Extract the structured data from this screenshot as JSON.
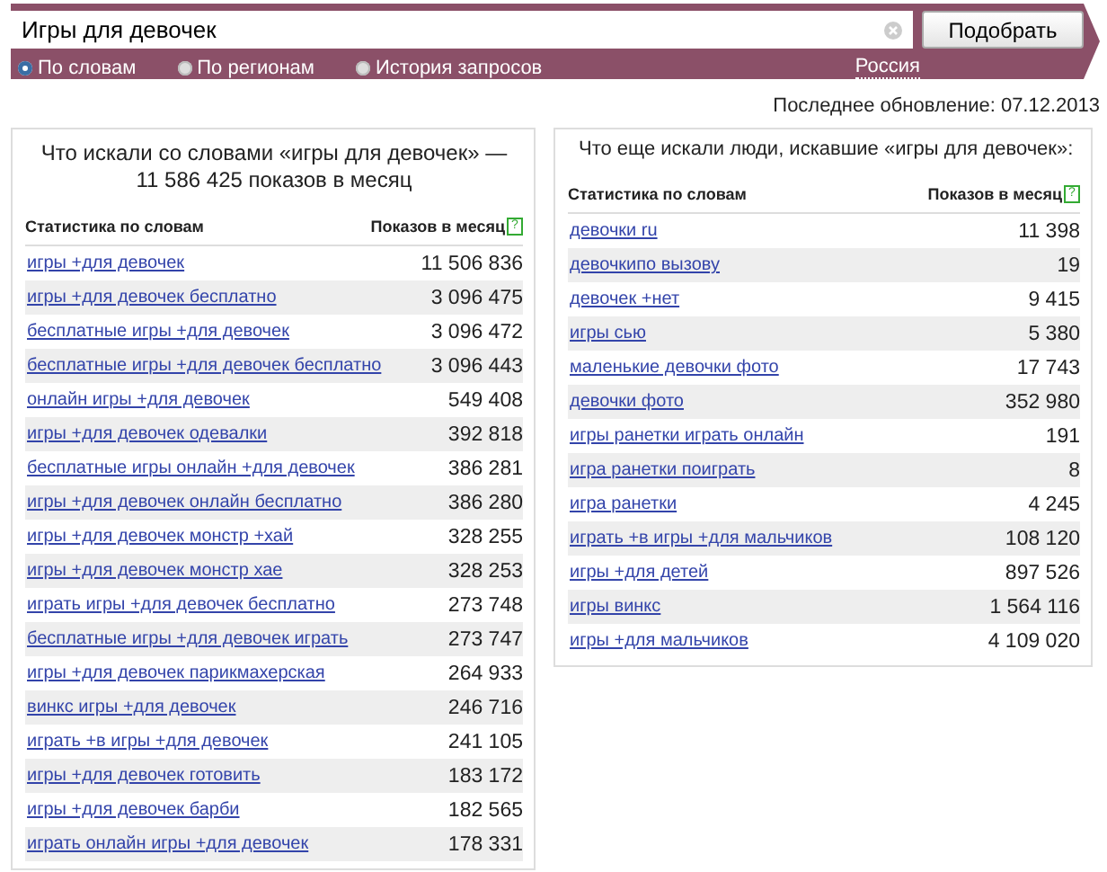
{
  "search": {
    "value": "Игры для девочек",
    "button": "Подобрать"
  },
  "modes": [
    {
      "label": "По словам",
      "selected": true
    },
    {
      "label": "По регионам",
      "selected": false
    },
    {
      "label": "История запросов",
      "selected": false
    }
  ],
  "region": "Россия",
  "last_update": "Последнее обновление: 07.12.2013",
  "panels": [
    {
      "title": "Что искали со словами «игры для девочек» — 11 586 425 показов в месяц",
      "columns": [
        "Статистика по словам",
        "Показов в месяц"
      ],
      "help": "?",
      "rows": [
        {
          "phrase": "игры +для девочек",
          "count": "11 506 836"
        },
        {
          "phrase": "игры +для девочек бесплатно",
          "count": "3 096 475"
        },
        {
          "phrase": "бесплатные игры +для девочек",
          "count": "3 096 472"
        },
        {
          "phrase": "бесплатные игры +для девочек бесплатно",
          "count": "3 096 443"
        },
        {
          "phrase": "онлайн игры +для девочек",
          "count": "549 408"
        },
        {
          "phrase": "игры +для девочек одевалки",
          "count": "392 818"
        },
        {
          "phrase": "бесплатные игры онлайн +для девочек",
          "count": "386 281"
        },
        {
          "phrase": "игры +для девочек онлайн бесплатно",
          "count": "386 280"
        },
        {
          "phrase": "игры +для девочек монстр +хай",
          "count": "328 255"
        },
        {
          "phrase": "игры +для девочек монстр хае",
          "count": "328 253"
        },
        {
          "phrase": "играть игры +для девочек бесплатно",
          "count": "273 748"
        },
        {
          "phrase": "бесплатные игры +для девочек играть",
          "count": "273 747"
        },
        {
          "phrase": "игры +для девочек парикмахерская",
          "count": "264 933"
        },
        {
          "phrase": "винкс игры +для девочек",
          "count": "246 716"
        },
        {
          "phrase": "играть +в игры +для девочек",
          "count": "241 105"
        },
        {
          "phrase": "игры +для девочек готовить",
          "count": "183 172"
        },
        {
          "phrase": "игры +для девочек барби",
          "count": "182 565"
        },
        {
          "phrase": "играть онлайн игры +для девочек",
          "count": "178 331"
        }
      ]
    },
    {
      "title": "Что еще искали люди, искавшие «игры для девочек»:",
      "columns": [
        "Статистика по словам",
        "Показов в месяц"
      ],
      "help": "?",
      "rows": [
        {
          "phrase": "девочки ru",
          "count": "11 398"
        },
        {
          "phrase": "девочкипо вызову",
          "count": "19"
        },
        {
          "phrase": "девочек +нет",
          "count": "9 415"
        },
        {
          "phrase": "игры сью",
          "count": "5 380"
        },
        {
          "phrase": "маленькие девочки фото",
          "count": "17 743"
        },
        {
          "phrase": "девочки фото",
          "count": "352 980"
        },
        {
          "phrase": "игры ранетки играть онлайн",
          "count": "191"
        },
        {
          "phrase": "игра ранетки поиграть",
          "count": "8"
        },
        {
          "phrase": "игра ранетки",
          "count": "4 245"
        },
        {
          "phrase": "играть +в игры +для мальчиков",
          "count": "108 120"
        },
        {
          "phrase": "игры +для детей",
          "count": "897 526"
        },
        {
          "phrase": "игры винкс",
          "count": "1 564 116"
        },
        {
          "phrase": "игры +для мальчиков",
          "count": "4 109 020"
        }
      ]
    }
  ]
}
